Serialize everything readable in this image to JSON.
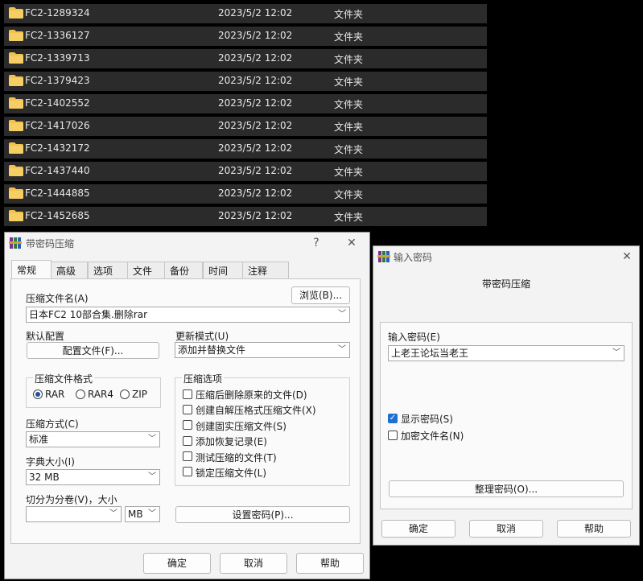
{
  "files": [
    {
      "name": "FC2-1289324",
      "date": "2023/5/2 12:02",
      "type": "文件夹"
    },
    {
      "name": "FC2-1336127",
      "date": "2023/5/2 12:02",
      "type": "文件夹"
    },
    {
      "name": "FC2-1339713",
      "date": "2023/5/2 12:02",
      "type": "文件夹"
    },
    {
      "name": "FC2-1379423",
      "date": "2023/5/2 12:02",
      "type": "文件夹"
    },
    {
      "name": "FC2-1402552",
      "date": "2023/5/2 12:02",
      "type": "文件夹"
    },
    {
      "name": "FC2-1417026",
      "date": "2023/5/2 12:02",
      "type": "文件夹"
    },
    {
      "name": "FC2-1432172",
      "date": "2023/5/2 12:02",
      "type": "文件夹"
    },
    {
      "name": "FC2-1437440",
      "date": "2023/5/2 12:02",
      "type": "文件夹"
    },
    {
      "name": "FC2-1444885",
      "date": "2023/5/2 12:02",
      "type": "文件夹"
    },
    {
      "name": "FC2-1452685",
      "date": "2023/5/2 12:02",
      "type": "文件夹"
    }
  ],
  "main_dialog": {
    "title": "带密码压缩",
    "help_glyph": "?",
    "close_glyph": "✕",
    "tabs": [
      "常规",
      "高级",
      "选项",
      "文件",
      "备份",
      "时间",
      "注释"
    ],
    "archive_name_label": "压缩文件名(A)",
    "browse_button": "浏览(B)...",
    "archive_name_value": "日本FC2 10部合集.删除rar",
    "default_profile_label": "默认配置",
    "profile_button": "配置文件(F)...",
    "update_mode_label": "更新模式(U)",
    "update_mode_value": "添加并替换文件",
    "format_group_title": "压缩文件格式",
    "format_rar": "RAR",
    "format_rar4": "RAR4",
    "format_zip": "ZIP",
    "options_group_title": "压缩选项",
    "options": [
      {
        "label": "压缩后删除原来的文件(D)",
        "checked": false
      },
      {
        "label": "创建自解压格式压缩文件(X)",
        "checked": false
      },
      {
        "label": "创建固实压缩文件(S)",
        "checked": false
      },
      {
        "label": "添加恢复记录(E)",
        "checked": false
      },
      {
        "label": "测试压缩的文件(T)",
        "checked": false
      },
      {
        "label": "锁定压缩文件(L)",
        "checked": false
      }
    ],
    "method_label": "压缩方式(C)",
    "method_value": "标准",
    "dict_label": "字典大小(I)",
    "dict_value": "32 MB",
    "split_label": "切分为分卷(V)，大小",
    "split_value": "",
    "split_unit": "MB",
    "set_password_button": "设置密码(P)...",
    "ok_button": "确定",
    "cancel_button": "取消",
    "help_button": "帮助"
  },
  "password_dialog": {
    "title": "输入密码",
    "close_glyph": "✕",
    "heading": "带密码压缩",
    "password_label": "输入密码(E)",
    "password_value": "上老王论坛当老王",
    "show_password_label": "显示密码(S)",
    "show_password_checked": true,
    "encrypt_names_label": "加密文件名(N)",
    "encrypt_names_checked": false,
    "organize_button": "整理密码(O)...",
    "ok_button": "确定",
    "cancel_button": "取消",
    "help_button": "帮助"
  },
  "colors": {
    "accent": "#1f6fd1",
    "folder": "#f2c14e",
    "row_bg": "#2b2b2b"
  },
  "icons": {
    "folder": "folder-icon",
    "app": "winrar-icon",
    "dropdown": "chevron-down-icon"
  }
}
